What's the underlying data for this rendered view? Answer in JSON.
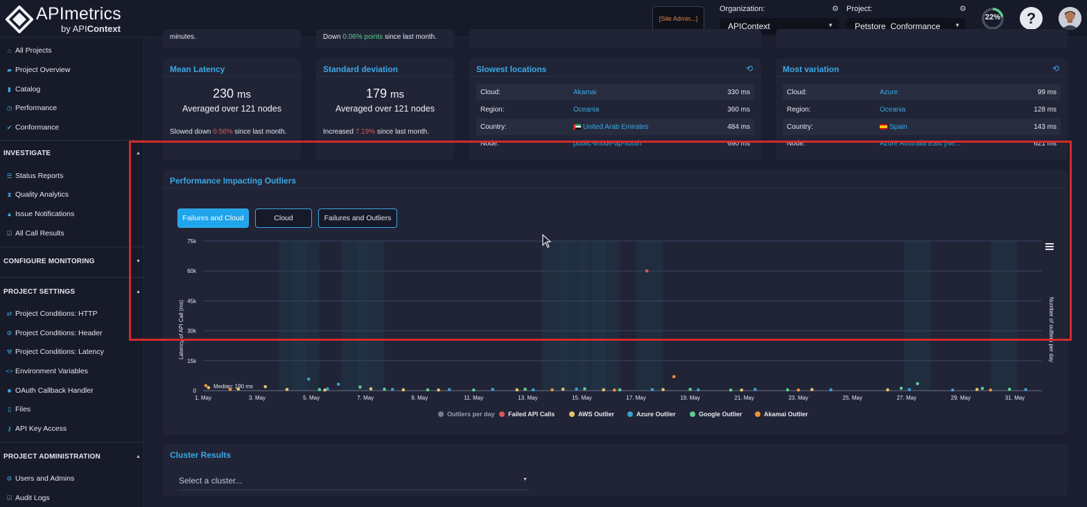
{
  "header": {
    "brand": "APImetrics",
    "brand_sub_prefix": "by API",
    "brand_sub_bold": "Context",
    "site_admin": "[Site Admin...]",
    "organization_label": "Organization:",
    "organization_value": "APIContext",
    "project_label": "Project:",
    "project_value": "Petstore_Conformance",
    "progress_text": "22%",
    "progress_fraction": 0.22,
    "help_label": "?",
    "accent_color": "#3ba9e6"
  },
  "sidebar": {
    "top_items": [
      {
        "label": "All Projects",
        "icon": "home-icon"
      },
      {
        "label": "Project Overview",
        "icon": "folder-icon"
      },
      {
        "label": "Catalog",
        "icon": "book-icon"
      },
      {
        "label": "Performance",
        "icon": "gauge-icon"
      },
      {
        "label": "Conformance",
        "icon": "check-icon"
      }
    ],
    "investigate": {
      "title": "INVESTIGATE",
      "items": [
        {
          "label": "Status Reports",
          "icon": "list-icon"
        },
        {
          "label": "Quality Analytics",
          "icon": "hourglass-icon"
        },
        {
          "label": "Issue Notifications",
          "icon": "bell-icon"
        },
        {
          "label": "All Call Results",
          "icon": "checkbox-icon"
        }
      ]
    },
    "configure": {
      "title": "CONFIGURE MONITORING"
    },
    "project_settings": {
      "title": "PROJECT SETTINGS",
      "items": [
        {
          "label": "Project Conditions: HTTP",
          "icon": "arrows-icon"
        },
        {
          "label": "Project Conditions: Header",
          "icon": "gear-icon"
        },
        {
          "label": "Project Conditions: Latency",
          "icon": "wrench-icon"
        },
        {
          "label": "Environment Variables",
          "icon": "code-icon"
        },
        {
          "label": "OAuth Callback Handler",
          "icon": "lock-icon"
        },
        {
          "label": "Files",
          "icon": "file-icon"
        },
        {
          "label": "API Key Access",
          "icon": "key-icon"
        }
      ]
    },
    "project_admin": {
      "title": "PROJECT ADMINISTRATION",
      "items": [
        {
          "label": "Users and Admins",
          "icon": "users-icon"
        },
        {
          "label": "Audit Logs",
          "icon": "checkbox-icon"
        }
      ]
    }
  },
  "top_partial": {
    "left_text": "minutes.",
    "mid_text_prefix": "Down ",
    "mid_text_value": "0.06% points",
    "mid_text_suffix": " since last month."
  },
  "mean_latency": {
    "title": "Mean Latency",
    "value": "230",
    "unit": "ms",
    "subtitle": "Averaged over 121 nodes",
    "delta_prefix": "Slowed down ",
    "delta_value": "0.56%",
    "delta_suffix": " since last month."
  },
  "std_dev": {
    "title": "Standard deviation",
    "value": "179",
    "unit": "ms",
    "subtitle": "Averaged over 121 nodes",
    "delta_prefix": "Increased ",
    "delta_value": "7.19%",
    "delta_suffix": " since last month."
  },
  "slowest_locations": {
    "title": "Slowest locations",
    "rows": [
      {
        "key": "Cloud:",
        "value": "Akamai",
        "ms": "330 ms"
      },
      {
        "key": "Region:",
        "value": "Oceania",
        "ms": "360 ms"
      },
      {
        "key": "Country:",
        "value": "United Arab Emirates",
        "ms": "484 ms",
        "flag": "uae-flag-icon"
      },
      {
        "key": "Node:",
        "value": "public-linode-ap-south",
        "ms": "690 ms"
      }
    ]
  },
  "most_variation": {
    "title": "Most variation",
    "rows": [
      {
        "key": "Cloud:",
        "value": "Azure",
        "ms": "99 ms"
      },
      {
        "key": "Region:",
        "value": "Oceania",
        "ms": "128 ms"
      },
      {
        "key": "Country:",
        "value": "Spain",
        "ms": "143 ms",
        "flag": "spain-flag-icon"
      },
      {
        "key": "Node:",
        "value": "Azure Australia East [Ne...",
        "ms": "621 ms"
      }
    ]
  },
  "outliers": {
    "title": "Performance Impacting Outliers",
    "tabs": [
      "Failures and Cloud",
      "Cloud",
      "Failures and Outliers"
    ],
    "active_tab": 0,
    "median_label": "Median: 190 ms"
  },
  "chart_data": {
    "type": "scatter",
    "ylabel": "Latency of API Call (ms)",
    "y2label": "Number of outliers per day",
    "ylim": [
      0,
      75000
    ],
    "yticks": [
      "0",
      "15k",
      "30k",
      "45k",
      "60k",
      "75k"
    ],
    "ytick_values": [
      0,
      15000,
      30000,
      45000,
      60000,
      75000
    ],
    "xlim": [
      1,
      32
    ],
    "xticks": [
      "1. May",
      "3. May",
      "5. May",
      "7. May",
      "9. May",
      "11. May",
      "13. May",
      "15. May",
      "17. May",
      "19. May",
      "21. May",
      "23. May",
      "25. May",
      "27. May",
      "29. May",
      "31. May"
    ],
    "xtick_values": [
      1,
      3,
      5,
      7,
      9,
      11,
      13,
      15,
      17,
      19,
      21,
      23,
      25,
      27,
      29,
      31
    ],
    "grid": true,
    "legend_position": "bottom",
    "median": 190,
    "outlier_days": [
      4.3,
      4.8,
      6.6,
      7.2,
      14.0,
      14.7,
      15.4,
      15.9,
      17.5,
      27.4,
      30.6
    ],
    "series": [
      {
        "name": "Outliers per day",
        "color": "#7a7f8c",
        "points": []
      },
      {
        "name": "Failed API Calls",
        "color": "#e05656",
        "points": [
          [
            17.4,
            60000
          ]
        ]
      },
      {
        "name": "AWS Outlier",
        "color": "#e9c46a",
        "points": [
          [
            1.2,
            1500
          ],
          [
            2.3,
            800
          ],
          [
            3.3,
            2000
          ],
          [
            4.1,
            600
          ],
          [
            5.5,
            300
          ],
          [
            7.2,
            900
          ],
          [
            8.4,
            400
          ],
          [
            9.7,
            300
          ],
          [
            12.6,
            400
          ],
          [
            14.3,
            700
          ],
          [
            15.8,
            400
          ],
          [
            18.0,
            500
          ],
          [
            20.9,
            300
          ],
          [
            23.5,
            500
          ],
          [
            26.3,
            400
          ],
          [
            29.6,
            600
          ]
        ]
      },
      {
        "name": "Azure Outlier",
        "color": "#3aa0d0",
        "points": [
          [
            4.9,
            5800
          ],
          [
            6.0,
            3200
          ],
          [
            5.6,
            900
          ],
          [
            8.0,
            600
          ],
          [
            10.1,
            500
          ],
          [
            11.7,
            600
          ],
          [
            13.2,
            400
          ],
          [
            14.8,
            800
          ],
          [
            17.6,
            500
          ],
          [
            19.3,
            400
          ],
          [
            21.4,
            600
          ],
          [
            24.2,
            400
          ],
          [
            27.1,
            500
          ],
          [
            28.7,
            300
          ],
          [
            31.4,
            500
          ]
        ]
      },
      {
        "name": "Google Outlier",
        "color": "#5ccf8e",
        "points": [
          [
            5.3,
            500
          ],
          [
            6.8,
            1800
          ],
          [
            7.7,
            700
          ],
          [
            9.3,
            400
          ],
          [
            11.0,
            300
          ],
          [
            12.9,
            700
          ],
          [
            15.1,
            900
          ],
          [
            16.4,
            400
          ],
          [
            19.0,
            600
          ],
          [
            20.5,
            300
          ],
          [
            22.6,
            400
          ],
          [
            26.8,
            1200
          ],
          [
            27.4,
            3500
          ],
          [
            29.8,
            1100
          ],
          [
            30.8,
            700
          ]
        ]
      },
      {
        "name": "Akamai Outlier",
        "color": "#f0913a",
        "points": [
          [
            1.1,
            2500
          ],
          [
            2.0,
            600
          ],
          [
            18.4,
            7000
          ],
          [
            16.2,
            300
          ],
          [
            13.9,
            400
          ],
          [
            23.0,
            300
          ],
          [
            30.1,
            300
          ]
        ]
      }
    ]
  },
  "cluster": {
    "title": "Cluster Results",
    "placeholder": "Select a cluster..."
  }
}
